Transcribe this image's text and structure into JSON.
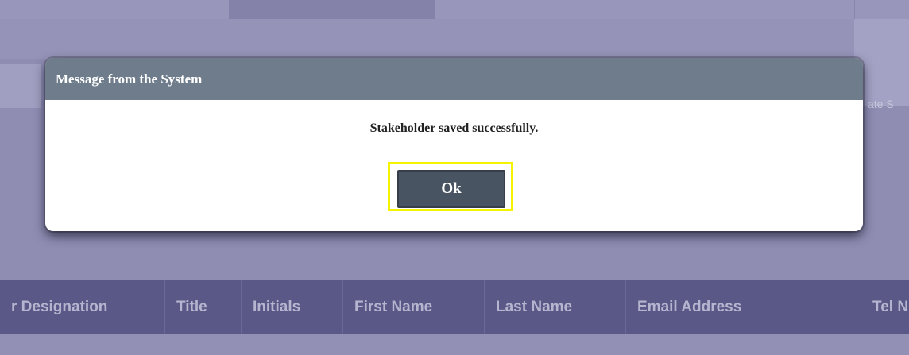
{
  "modal": {
    "title": "Message from the System",
    "message": "Stakeholder saved successfully.",
    "ok_label": "Ok"
  },
  "background": {
    "partial_header_right": "ate S",
    "table_columns": [
      "r Designation",
      "Title",
      "Initials",
      "First Name",
      "Last Name",
      "Email Address",
      "Tel N"
    ]
  }
}
